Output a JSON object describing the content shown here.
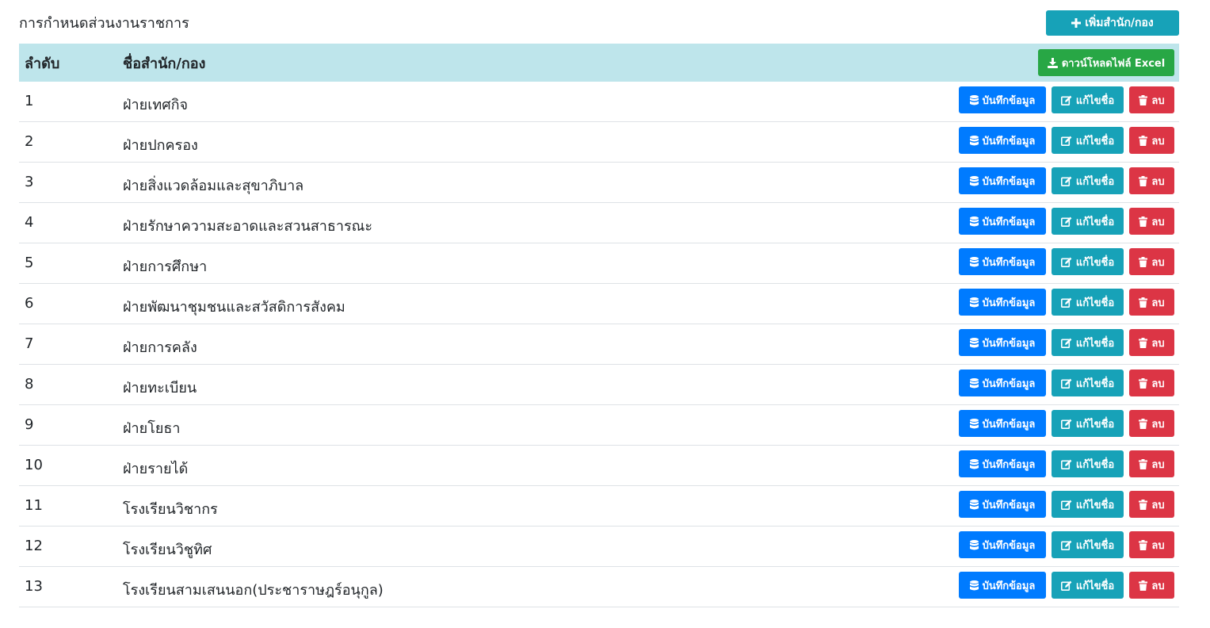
{
  "page": {
    "title": "การกำหนดส่วนงานราชการ",
    "add_button": "เพิ่มสำนัก/กอง"
  },
  "table": {
    "headers": {
      "no": "ลำดับ",
      "name": "ชื่อสำนัก/กอง"
    },
    "excel_button": "ดาวน์โหลดไฟล์ Excel",
    "row_actions": {
      "save": "บันทึกข้อมูล",
      "edit": "แก้ไขชื่อ",
      "delete": "ลบ"
    },
    "rows": [
      {
        "no": "1",
        "name": "ฝ่ายเทศกิจ"
      },
      {
        "no": "2",
        "name": "ฝ่ายปกครอง"
      },
      {
        "no": "3",
        "name": "ฝ่ายสิ่งแวดล้อมและสุขาภิบาล"
      },
      {
        "no": "4",
        "name": "ฝ่ายรักษาความสะอาดและสวนสาธารณะ"
      },
      {
        "no": "5",
        "name": "ฝ่ายการศึกษา"
      },
      {
        "no": "6",
        "name": "ฝ่ายพัฒนาชุมชนและสวัสดิการสังคม"
      },
      {
        "no": "7",
        "name": "ฝ่ายการคลัง"
      },
      {
        "no": "8",
        "name": "ฝ่ายทะเบียน"
      },
      {
        "no": "9",
        "name": "ฝ่ายโยธา"
      },
      {
        "no": "10",
        "name": "ฝ่ายรายได้"
      },
      {
        "no": "11",
        "name": "โรงเรียนวิชากร"
      },
      {
        "no": "12",
        "name": "โรงเรียนวิชูทิศ"
      },
      {
        "no": "13",
        "name": "โรงเรียนสามเสนนอก(ประชาราษฎร์อนุกูล)"
      }
    ]
  },
  "colors": {
    "header_bg": "#bee5eb",
    "info": "#17a2b8",
    "success": "#28a745",
    "primary": "#007bff",
    "danger": "#dc3545"
  },
  "icons": {
    "add": "plus-icon",
    "excel": "download-icon",
    "save": "database-icon",
    "edit": "edit-icon",
    "delete": "trash-icon"
  }
}
